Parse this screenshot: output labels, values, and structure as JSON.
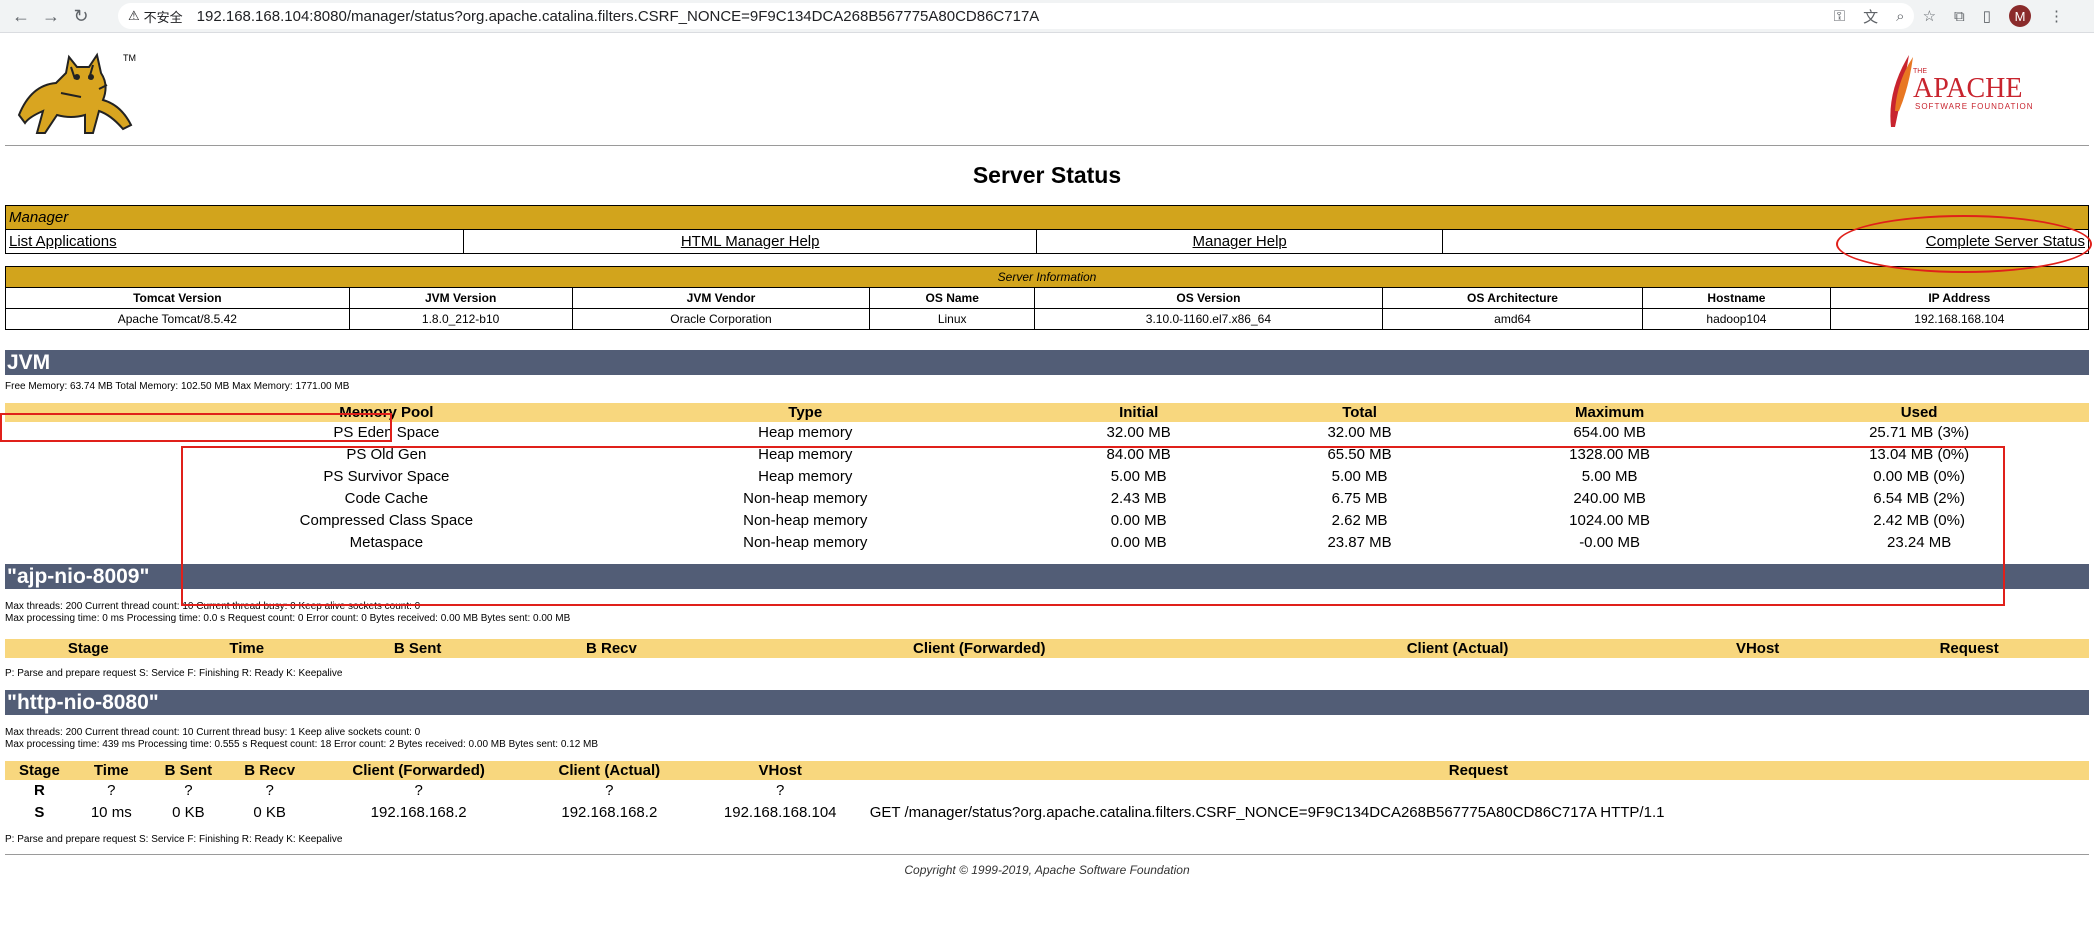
{
  "browser": {
    "security_label": "不安全",
    "url": "192.168.168.104:8080/manager/status?org.apache.catalina.filters.CSRF_NONCE=9F9C134DCA268B567775A80CD86C717A",
    "avatar_letter": "M"
  },
  "page_title": "Server Status",
  "manager": {
    "header": "Manager",
    "links": [
      "List Applications",
      "HTML Manager Help",
      "Manager Help",
      "Complete Server Status"
    ]
  },
  "server_info": {
    "header": "Server Information",
    "columns": [
      "Tomcat Version",
      "JVM Version",
      "JVM Vendor",
      "OS Name",
      "OS Version",
      "OS Architecture",
      "Hostname",
      "IP Address"
    ],
    "values": [
      "Apache Tomcat/8.5.42",
      "1.8.0_212-b10",
      "Oracle Corporation",
      "Linux",
      "3.10.0-1160.el7.x86_64",
      "amd64",
      "hadoop104",
      "192.168.168.104"
    ]
  },
  "jvm": {
    "title": "JVM",
    "memory_line": "Free Memory: 63.74 MB Total Memory: 102.50 MB Max Memory: 1771.00 MB",
    "columns": [
      "Memory Pool",
      "Type",
      "Initial",
      "Total",
      "Maximum",
      "Used"
    ],
    "rows": [
      [
        "PS Eden Space",
        "Heap memory",
        "32.00 MB",
        "32.00 MB",
        "654.00 MB",
        "25.71 MB (3%)"
      ],
      [
        "PS Old Gen",
        "Heap memory",
        "84.00 MB",
        "65.50 MB",
        "1328.00 MB",
        "13.04 MB (0%)"
      ],
      [
        "PS Survivor Space",
        "Heap memory",
        "5.00 MB",
        "5.00 MB",
        "5.00 MB",
        "0.00 MB (0%)"
      ],
      [
        "Code Cache",
        "Non-heap memory",
        "2.43 MB",
        "6.75 MB",
        "240.00 MB",
        "6.54 MB (2%)"
      ],
      [
        "Compressed Class Space",
        "Non-heap memory",
        "0.00 MB",
        "2.62 MB",
        "1024.00 MB",
        "2.42 MB (0%)"
      ],
      [
        "Metaspace",
        "Non-heap memory",
        "0.00 MB",
        "23.87 MB",
        "-0.00 MB",
        "23.24 MB"
      ]
    ]
  },
  "ajp": {
    "title": "\"ajp-nio-8009\"",
    "line1": "Max threads: 200 Current thread count: 10 Current thread busy: 0 Keep alive sockets count: 0",
    "line2": "Max processing time: 0 ms Processing time: 0.0 s Request count: 0 Error count: 0 Bytes received: 0.00 MB Bytes sent: 0.00 MB",
    "columns": [
      "Stage",
      "Time",
      "B Sent",
      "B Recv",
      "Client (Forwarded)",
      "Client (Actual)",
      "VHost",
      "Request"
    ],
    "legend": "P: Parse and prepare request S: Service F: Finishing R: Ready K: Keepalive"
  },
  "http": {
    "title": "\"http-nio-8080\"",
    "line1": "Max threads: 200 Current thread count: 10 Current thread busy: 1 Keep alive sockets count: 0",
    "line2": "Max processing time: 439 ms Processing time: 0.555 s Request count: 18 Error count: 2 Bytes received: 0.00 MB Bytes sent: 0.12 MB",
    "columns": [
      "Stage",
      "Time",
      "B Sent",
      "B Recv",
      "Client (Forwarded)",
      "Client (Actual)",
      "VHost",
      "Request"
    ],
    "rows": [
      [
        "R",
        "?",
        "?",
        "?",
        "?",
        "?",
        "?",
        ""
      ],
      [
        "S",
        "10 ms",
        "0 KB",
        "0 KB",
        "192.168.168.2",
        "192.168.168.2",
        "192.168.168.104",
        "GET /manager/status?org.apache.catalina.filters.CSRF_NONCE=9F9C134DCA268B567775A80CD86C717A HTTP/1.1"
      ]
    ],
    "legend": "P: Parse and prepare request S: Service F: Finishing R: Ready K: Keepalive"
  },
  "copyright": "Copyright © 1999-2019, Apache Software Foundation",
  "logos": {
    "tomcat_tm": "TM",
    "apache_the": "THE",
    "apache_name": "APACHE",
    "apache_sub": "SOFTWARE FOUNDATION"
  },
  "colors": {
    "gold": "#d2a41c",
    "light_gold": "#f8d77e",
    "slate": "#525d76",
    "annotation_red": "#e0201a"
  }
}
